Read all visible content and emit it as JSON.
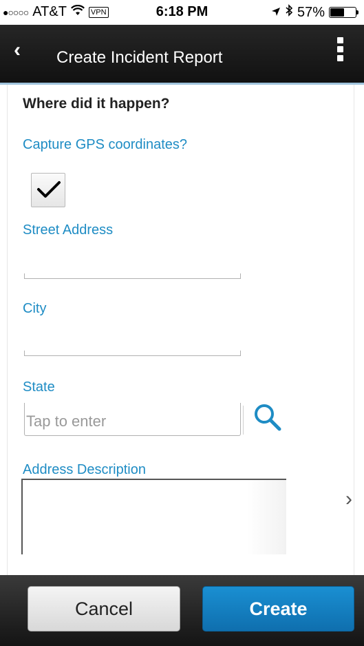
{
  "status_bar": {
    "signal": "●○○○○",
    "carrier": "AT&T",
    "wifi_icon": "wifi-icon",
    "vpn": "VPN",
    "time": "6:18 PM",
    "location_icon": "location-arrow-icon",
    "bluetooth_icon": "bluetooth-icon",
    "battery_percent": "57%",
    "battery_level": 0.57
  },
  "header": {
    "back_icon": "‹",
    "title": "Create Incident Report",
    "menu_icon": "kebab-menu-icon"
  },
  "form": {
    "section_heading": "Where did it happen?",
    "gps_label": "Capture GPS coordinates?",
    "gps_checked": true,
    "street_label": "Street Address",
    "street_value": "",
    "city_label": "City",
    "city_value": "",
    "state_label": "State",
    "state_placeholder": "Tap to enter",
    "address_desc_label": "Address Description",
    "address_desc_value": ""
  },
  "footer": {
    "cancel_label": "Cancel",
    "create_label": "Create"
  },
  "colors": {
    "accent_blue": "#1e8cc4",
    "create_button": "#1480c2",
    "header_bg": "#1c1c1c"
  }
}
